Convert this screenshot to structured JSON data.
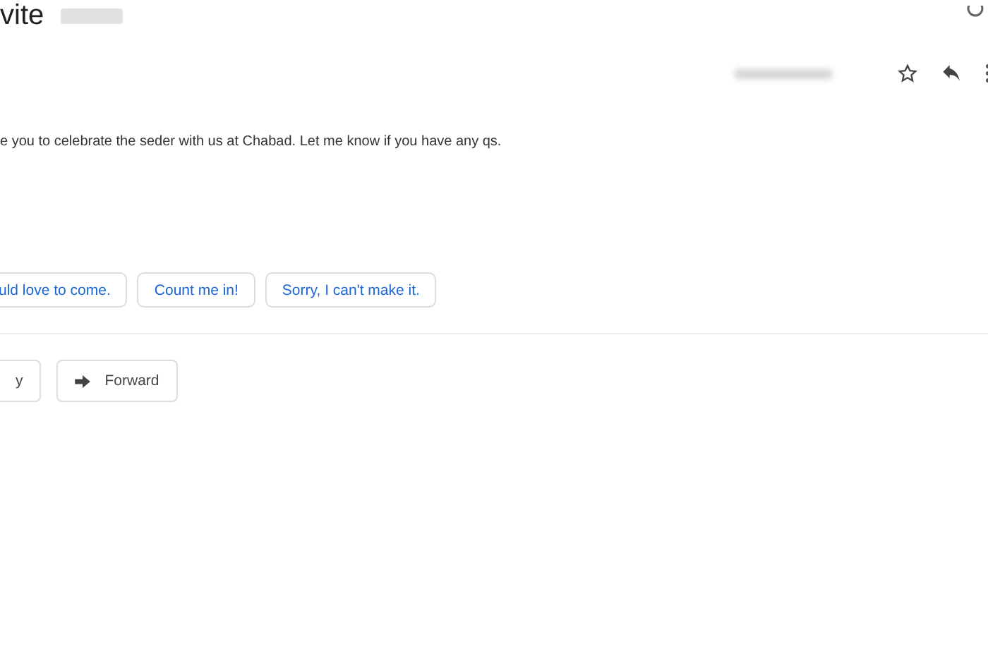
{
  "subject": "vite",
  "message": {
    "body": "e you to celebrate the seder with us at Chabad. Let me know if you have any qs."
  },
  "smart_replies": [
    {
      "label": "uld love to come."
    },
    {
      "label": "Count me in!"
    },
    {
      "label": "Sorry, I can't make it."
    }
  ],
  "actions": [
    {
      "label": "y",
      "kind": "reply"
    },
    {
      "label": "Forward",
      "kind": "forward"
    }
  ]
}
